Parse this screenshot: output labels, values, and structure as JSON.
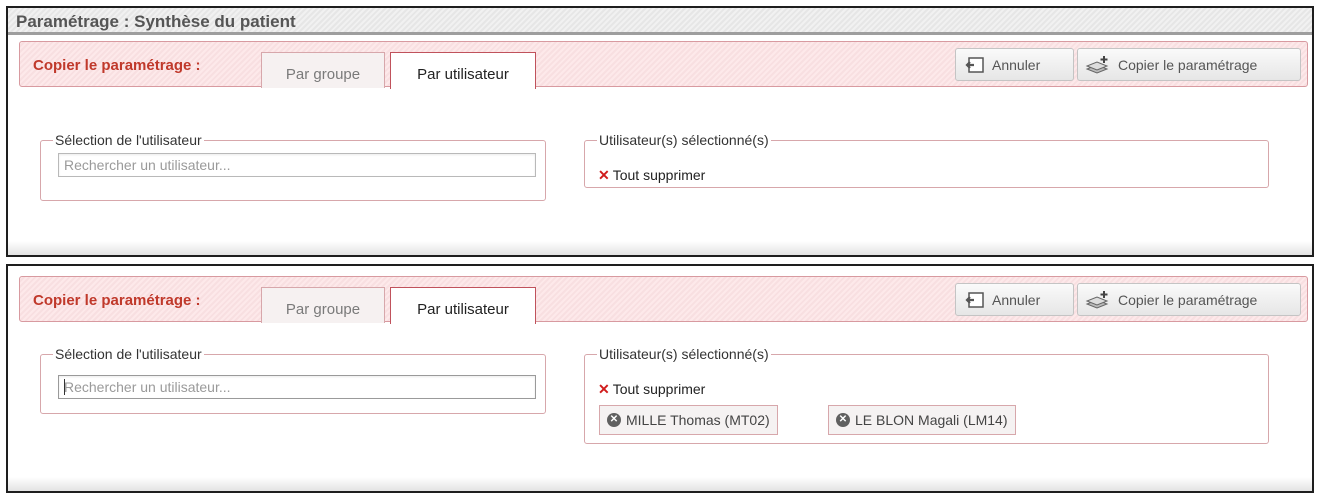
{
  "page_title": "Paramétrage : Synthèse du patient",
  "panels": [
    {
      "copy_label": "Copier le paramétrage :",
      "tabs": [
        {
          "label": "Par groupe",
          "active": false
        },
        {
          "label": "Par utilisateur",
          "active": true
        }
      ],
      "buttons": {
        "cancel": "Annuler",
        "copy": "Copier le paramétrage"
      },
      "user_selection": {
        "legend": "Sélection de l'utilisateur",
        "search_placeholder": "Rechercher un utilisateur...",
        "search_value": ""
      },
      "selected_users": {
        "legend": "Utilisateur(s) sélectionné(s)",
        "clear_all": "Tout supprimer",
        "chips": []
      }
    },
    {
      "copy_label": "Copier le paramétrage :",
      "tabs": [
        {
          "label": "Par groupe",
          "active": false
        },
        {
          "label": "Par utilisateur",
          "active": true
        }
      ],
      "buttons": {
        "cancel": "Annuler",
        "copy": "Copier le paramétrage"
      },
      "user_selection": {
        "legend": "Sélection de l'utilisateur",
        "search_placeholder": "Rechercher un utilisateur...",
        "search_value": ""
      },
      "selected_users": {
        "legend": "Utilisateur(s) sélectionné(s)",
        "clear_all": "Tout supprimer",
        "chips": [
          {
            "label": "MILLE Thomas (MT02)"
          },
          {
            "label": "LE BLON Magali (LM14)"
          }
        ]
      }
    }
  ],
  "icons": {
    "cancel": "undo-icon",
    "copy": "copy-layers-icon",
    "clear": "x-mark-icon",
    "chip_remove": "circle-x-icon"
  },
  "colors": {
    "accent": "#c0392b",
    "clear_x": "#d01c1c",
    "border": "#d7a7ab",
    "toolbar_bg": "#fde9ea"
  }
}
